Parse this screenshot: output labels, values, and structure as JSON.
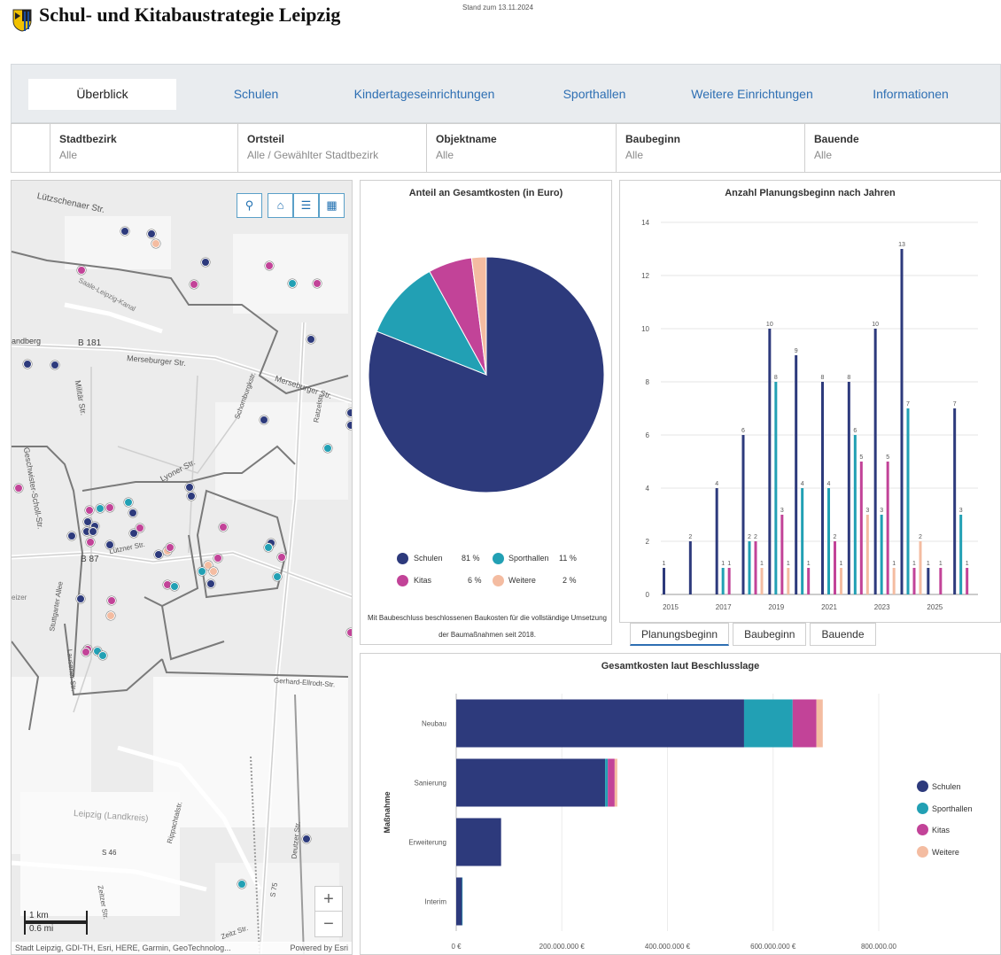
{
  "header": {
    "title": "Schul- und Kitabaustrategie Leipzig",
    "stand": "Stand zum 13.11.2024"
  },
  "nav": {
    "tabs": [
      {
        "label": "Überblick",
        "active": true
      },
      {
        "label": "Schulen"
      },
      {
        "label": "Kindertageseinrichtungen"
      },
      {
        "label": "Sporthallen"
      },
      {
        "label": "Weitere Einrichtungen"
      },
      {
        "label": "Informationen"
      }
    ]
  },
  "filters": [
    {
      "label": "Stadtbezirk",
      "value": "Alle"
    },
    {
      "label": "Ortsteil",
      "value": "Alle / Gewählter Stadtbezirk"
    },
    {
      "label": "Objektname",
      "value": "Alle"
    },
    {
      "label": "Baubeginn",
      "value": "Alle"
    },
    {
      "label": "Bauende",
      "value": "Alle"
    }
  ],
  "map": {
    "street_labels": [
      "Lützschenaer Str.",
      "Saale-Leipzig-Kanal",
      "B 181",
      "Merseburger Str.",
      "Merseburger Str.",
      "Militär Str.",
      "Schomburgkstr.",
      "Lyoner Str.",
      "Geschwister-Scholl-Str.",
      "B 87",
      "Lützner Str.",
      "Stuttgarter Allee",
      "Lausener Str.",
      "Gerhard-Ellrodt-Str.",
      "Leipzig (Landkreis)",
      "Rippachtalstr.",
      "S 46",
      "Zeitzer Str.",
      "S 75",
      "Deutzer Str.",
      "Zeitz Str.",
      "andberg",
      "eizer",
      "Ratzelstr."
    ],
    "scale_km": "1 km",
    "scale_mi": "0.6 mi",
    "attribution": "Stadt Leipzig, GDI-TH, Esri, HERE, Garmin, GeoTechnolog...",
    "powered": "Powered by Esri",
    "tool_icons": [
      "search-icon",
      "home-icon",
      "legend-list-icon",
      "qr-code-icon"
    ],
    "zoom_in": "+",
    "zoom_out": "−",
    "point_colors": {
      "Schulen": "#2d3a7c",
      "Sporthallen": "#22a0b4",
      "Kitas": "#c24398",
      "Weitere": "#f4bca1"
    }
  },
  "pie": {
    "chart_data": {
      "type": "pie",
      "title": "Anteil an Gesamtkosten (in Euro)",
      "slices": [
        {
          "name": "Schulen",
          "value": 81,
          "label": "81 %",
          "color": "#2d3a7c"
        },
        {
          "name": "Sporthallen",
          "value": 11,
          "label": "11 %",
          "color": "#22a0b4"
        },
        {
          "name": "Kitas",
          "value": 6,
          "label": "6 %",
          "color": "#c24398"
        },
        {
          "name": "Weitere",
          "value": 2,
          "label": "2 %",
          "color": "#f4bca1"
        }
      ]
    },
    "caption": "Mit Baubeschluss beschlossenen Baukosten für die vollständige Umsetzung der Baumaßnahmen seit 2018."
  },
  "bar": {
    "chart_data": {
      "type": "bar",
      "title": "Anzahl Planungsbeginn nach Jahren",
      "categories": [
        "2015",
        "2016",
        "2017",
        "2018",
        "2019",
        "2020",
        "2021",
        "2022",
        "2023",
        "2024",
        "2025",
        "2026"
      ],
      "x_tick_labels": [
        "2015",
        "2017",
        "2019",
        "2021",
        "2023",
        "2025"
      ],
      "ylim": [
        0,
        14
      ],
      "y_ticks": [
        "0",
        "2",
        "4",
        "6",
        "8",
        "10",
        "12",
        "14"
      ],
      "grid": true,
      "series": [
        {
          "name": "Schulen",
          "color": "#2d3a7c",
          "values": [
            1,
            2,
            4,
            6,
            10,
            9,
            8,
            8,
            10,
            13,
            1,
            7
          ]
        },
        {
          "name": "Sporthallen",
          "color": "#22a0b4",
          "values": [
            null,
            null,
            1,
            2,
            8,
            4,
            4,
            6,
            3,
            7,
            null,
            3
          ]
        },
        {
          "name": "Kitas",
          "color": "#c24398",
          "values": [
            null,
            null,
            1,
            2,
            3,
            1,
            2,
            5,
            5,
            1,
            1,
            1
          ]
        },
        {
          "name": "Weitere",
          "color": "#f4bca1",
          "values": [
            null,
            null,
            null,
            1,
            1,
            null,
            1,
            3,
            1,
            2,
            null,
            null
          ]
        }
      ]
    },
    "tabs": [
      {
        "label": "Planungsbeginn",
        "active": true
      },
      {
        "label": "Baubeginn"
      },
      {
        "label": "Bauende"
      }
    ]
  },
  "hbar": {
    "chart_data": {
      "type": "bar",
      "orientation": "horizontal",
      "stacked": true,
      "title": "Gesamtkosten laut Beschlusslage",
      "ylabel": "Maßnahme",
      "categories": [
        "Neubau",
        "Sanierung",
        "Erweiterung",
        "Interim"
      ],
      "x_ticks": [
        "0 €",
        "200.000.000 €",
        "400.000.000 €",
        "600.000.000 €",
        "800.000.00"
      ],
      "xlim": [
        0,
        800000000
      ],
      "series": [
        {
          "name": "Schulen",
          "color": "#2d3a7c",
          "values": [
            545000000,
            282000000,
            85000000,
            11000000
          ]
        },
        {
          "name": "Sporthallen",
          "color": "#22a0b4",
          "values": [
            92000000,
            5000000,
            0,
            1000000
          ]
        },
        {
          "name": "Kitas",
          "color": "#c24398",
          "values": [
            45000000,
            13000000,
            0,
            0
          ]
        },
        {
          "name": "Weitere",
          "color": "#f4bca1",
          "values": [
            12000000,
            5000000,
            0,
            0
          ]
        }
      ],
      "legend_position": "right"
    }
  }
}
